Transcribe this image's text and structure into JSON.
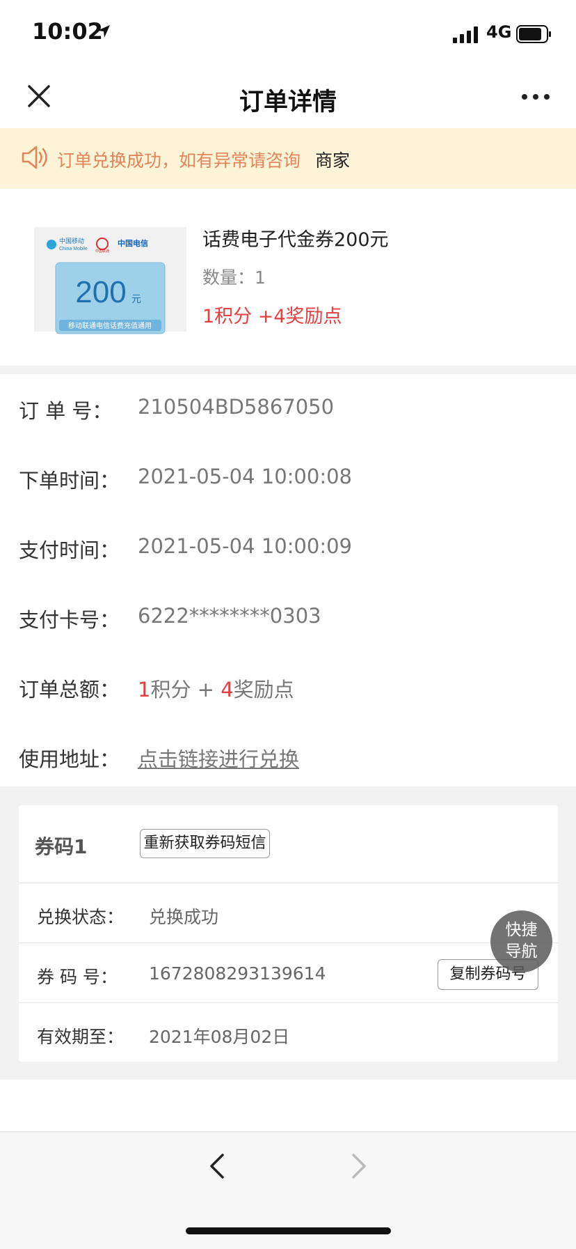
{
  "status_bar": {
    "time": "10:02",
    "network": "4G"
  },
  "nav": {
    "title": "订单详情"
  },
  "banner": {
    "text": "订单兑换成功，如有异常请咨询",
    "link": "商家"
  },
  "product": {
    "name": "话费电子代金券200元",
    "qty_label": "数量：",
    "qty": "1",
    "price": "1积分 +4奖励点",
    "thumb": {
      "amount": "200",
      "unit": "元",
      "caption": "移动联通电信话费充值通用",
      "logo_texts": [
        "中国移动",
        "China Mobile",
        "中国联通",
        "中国电信"
      ]
    }
  },
  "order": {
    "number_label": "订 单 号：",
    "number": "210504BD5867050",
    "order_time_label": "下单时间：",
    "order_time": "2021-05-04 10:00:08",
    "pay_time_label": "支付时间：",
    "pay_time": "2021-05-04 10:00:09",
    "card_label": "支付卡号：",
    "card": "6222********0303",
    "total_label": "订单总额：",
    "total_points": "1",
    "total_points_unit": "积分 + ",
    "total_reward": "4",
    "total_reward_unit": "奖励点",
    "address_label": "使用地址：",
    "address_link": "点击链接进行兑换"
  },
  "coupon": {
    "title": "券码1",
    "resend_button": "重新获取券码短信",
    "status_label": "兑换状态：",
    "status": "兑换成功",
    "code_label": "券 码 号：",
    "code": "1672808293139614",
    "copy_button": "复制券码号",
    "expiry_label": "有效期至：",
    "expiry": "2021年08月02日"
  },
  "fab": {
    "line1": "快捷",
    "line2": "导航"
  },
  "colors": {
    "accent_red": "#e54040",
    "banner_bg": "#fdf4d8",
    "banner_text": "#e2855a"
  }
}
